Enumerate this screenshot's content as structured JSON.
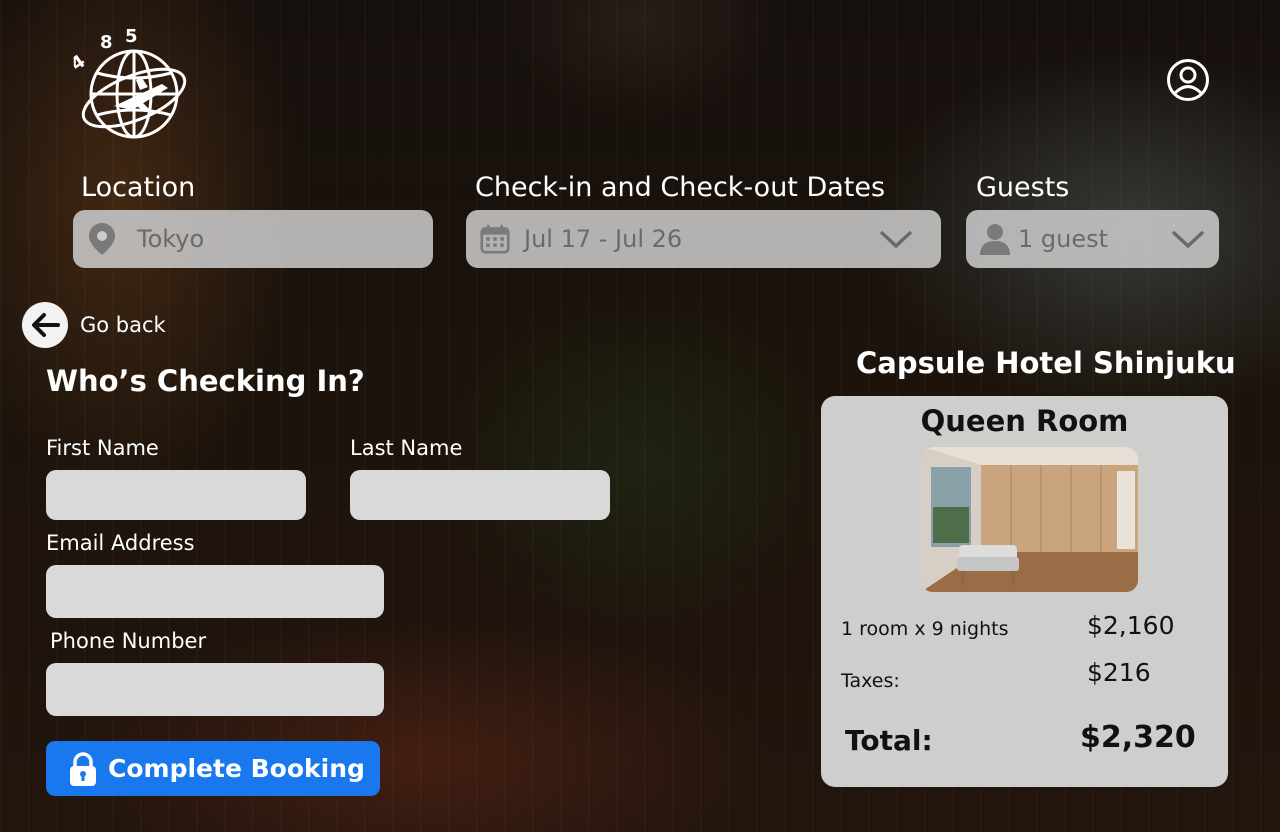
{
  "logo": {
    "text": "485"
  },
  "search": {
    "location_label": "Location",
    "location_value": "Tokyo",
    "dates_label": "Check-in and Check-out Dates",
    "dates_value": "Jul 17 - Jul 26",
    "guests_label": "Guests",
    "guests_value": "1 guest"
  },
  "nav": {
    "go_back": "Go back"
  },
  "form": {
    "title": "Who’s Checking In?",
    "first_name_label": "First Name",
    "last_name_label": "Last Name",
    "email_label": "Email Address",
    "phone_label": "Phone Number",
    "first_name_value": "",
    "last_name_value": "",
    "email_value": "",
    "phone_value": "",
    "submit_label": "Complete Booking"
  },
  "summary": {
    "hotel_name": "Capsule Hotel Shinjuku",
    "room_type": "Queen Room",
    "room_line_label": "1 room x 9 nights",
    "room_line_value": "$2,160",
    "taxes_label": "Taxes:",
    "taxes_value": "$216",
    "total_label": "Total:",
    "total_value": "$2,320"
  },
  "icons": {
    "profile": "user-circle-icon",
    "location": "map-pin-icon",
    "dates": "calendar-icon",
    "guests": "person-icon",
    "dropdown": "chevron-down-icon",
    "back": "arrow-left-icon",
    "lock": "lock-icon"
  },
  "colors": {
    "primary_button": "#1978ee",
    "input_fill": "#d9d9d9",
    "search_fill": "#cdcdcd",
    "card_fill": "#dadada"
  }
}
